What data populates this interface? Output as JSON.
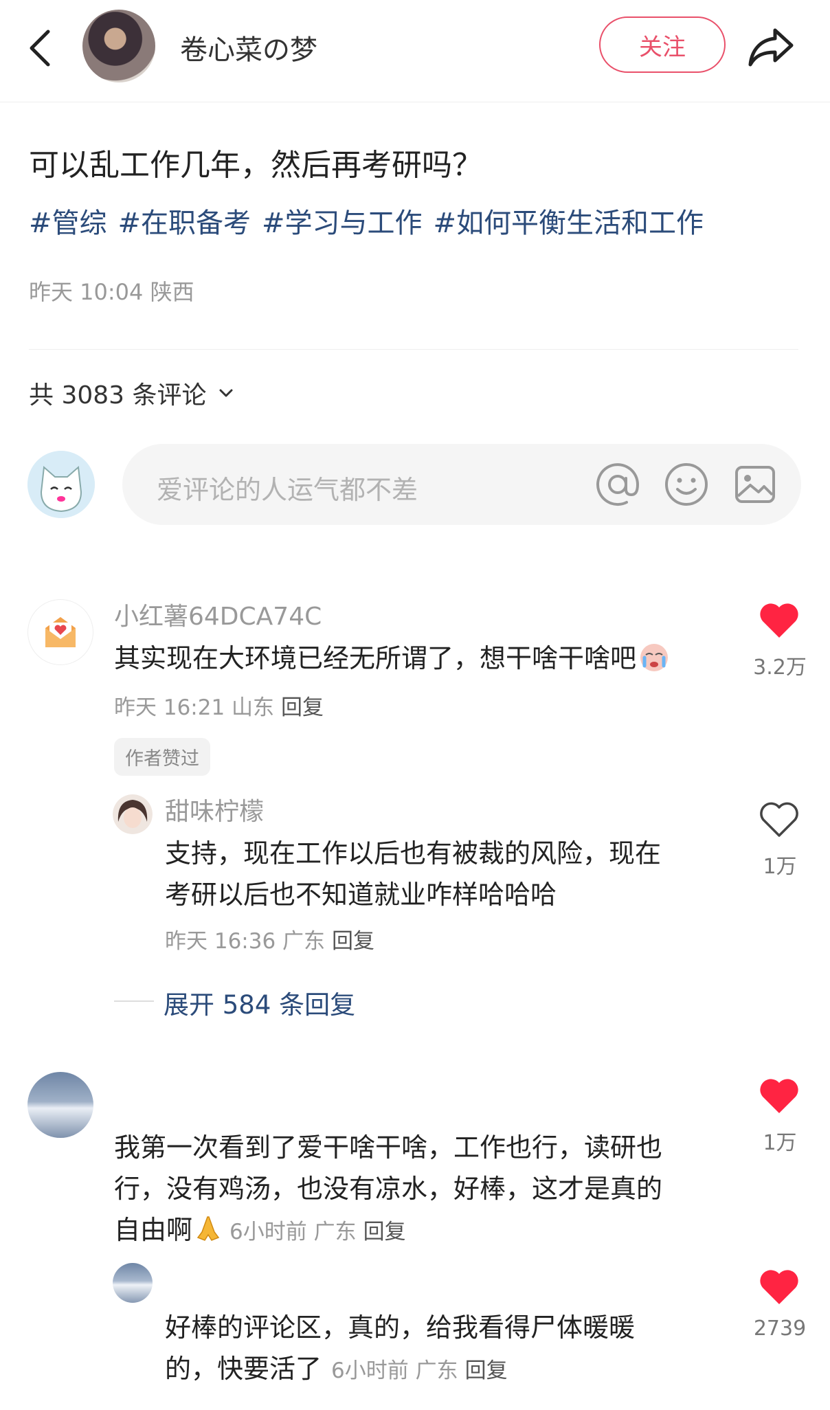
{
  "header": {
    "author_name": "卷心菜の梦",
    "follow_label": "关注",
    "icons": [
      "back-icon",
      "share-icon"
    ]
  },
  "post": {
    "title": "可以乱工作几年，然后再考研吗？",
    "tags": [
      "#管综",
      "#在职备考",
      "#学习与工作",
      "#如何平衡生活和工作"
    ],
    "meta": "昨天 10:04 陕西"
  },
  "comments_header": {
    "count_label": "共 3083 条评论"
  },
  "comment_input": {
    "placeholder": "爱评论的人运气都不差",
    "icons": [
      "at-icon",
      "emoji-icon",
      "image-icon"
    ]
  },
  "comments": [
    {
      "user": "小红薯64DCA74C",
      "text": "其实现在大环境已经无所谓了，想干啥干啥吧",
      "meta_time": "昨天 16:21 山东",
      "reply_label": "回复",
      "badge": "作者赞过",
      "likes": "3.2万",
      "liked": true,
      "replies": [
        {
          "user": "甜味柠檬",
          "text_lines": [
            "支持，现在工作以后也有被裁的风险，现在",
            "考研以后也不知道就业咋样哈哈哈"
          ],
          "meta_time": "昨天 16:36 广东",
          "reply_label": "回复",
          "likes": "1万",
          "liked": false
        }
      ],
      "expand_label": "展开 584 条回复"
    },
    {
      "user": "",
      "text_lines": [
        "我第一次看到了爱干啥干啥，工作也行，读研也",
        "行，没有鸡汤，也没有凉水，好棒，这才是真的",
        "自由啊"
      ],
      "meta_time": "6小时前 广东",
      "reply_label": "回复",
      "likes": "1万",
      "liked": true,
      "replies": [
        {
          "user": "",
          "text_lines": [
            "好棒的评论区，真的，给我看得尸体暖暖",
            "的，快要活了"
          ],
          "meta_time": "6小时前 广东",
          "reply_label": "回复",
          "likes": "2739",
          "liked": true
        }
      ]
    }
  ],
  "colors": {
    "accent_red": "#ff2442",
    "link_blue": "#2b4b7a",
    "follow_red": "#e9506a"
  }
}
